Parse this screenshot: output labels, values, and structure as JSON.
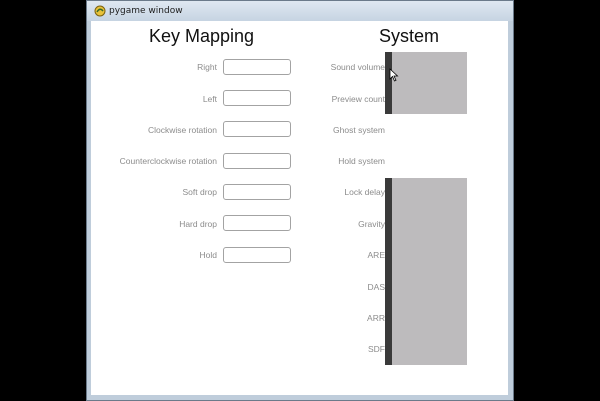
{
  "window": {
    "title": "pygame window"
  },
  "key_mapping": {
    "heading": "Key Mapping",
    "rows": [
      {
        "label": "Right"
      },
      {
        "label": "Left"
      },
      {
        "label": "Clockwise rotation"
      },
      {
        "label": "Counterclockwise rotation"
      },
      {
        "label": "Soft drop"
      },
      {
        "label": "Hard drop"
      },
      {
        "label": "Hold"
      }
    ]
  },
  "system": {
    "heading": "System",
    "rows": [
      {
        "label": "Sound volume"
      },
      {
        "label": "Preview count"
      },
      {
        "label": "Ghost system"
      },
      {
        "label": "Hold system"
      },
      {
        "label": "Lock delay"
      },
      {
        "label": "Gravity"
      },
      {
        "label": "ARE"
      },
      {
        "label": "DAS"
      },
      {
        "label": "ARR"
      },
      {
        "label": "SDF"
      }
    ]
  },
  "colors": {
    "panel": "#bdbbbd",
    "bar": "#3a3a3a",
    "label": "#8c8c8c"
  },
  "icons": {
    "title": "pygame-snake-icon",
    "cursor": "mouse-pointer-icon"
  }
}
